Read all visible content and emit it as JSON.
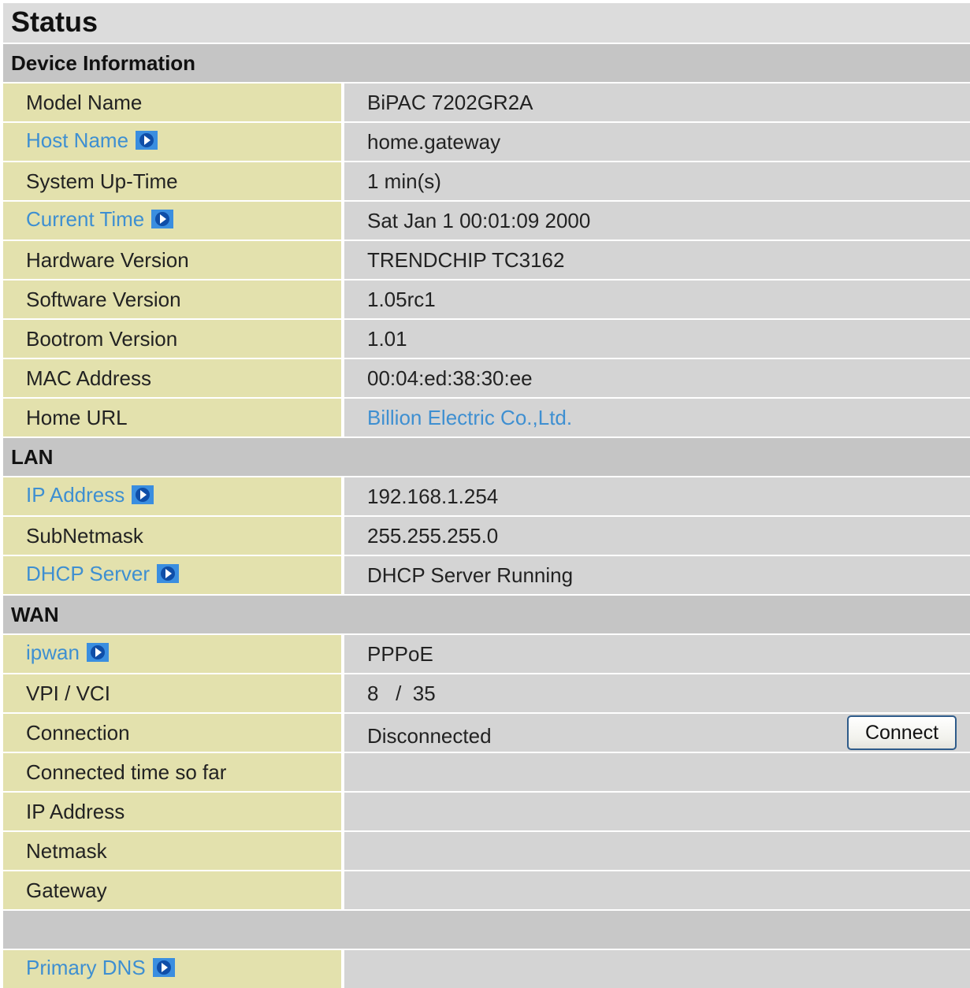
{
  "page": {
    "title": "Status"
  },
  "sections": {
    "device_information": "Device Information",
    "lan": "LAN",
    "wan": "WAN"
  },
  "device": {
    "model_name_label": "Model Name",
    "model_name_value": "BiPAC 7202GR2A",
    "host_name_label": "Host Name",
    "host_name_value": "home.gateway",
    "system_uptime_label": "System Up-Time",
    "system_uptime_value": "1 min(s)",
    "current_time_label": "Current Time",
    "current_time_value": "Sat Jan 1 00:01:09 2000",
    "hardware_version_label": "Hardware Version",
    "hardware_version_value": "TRENDCHIP TC3162",
    "software_version_label": "Software Version",
    "software_version_value": "1.05rc1",
    "bootrom_version_label": "Bootrom Version",
    "bootrom_version_value": "1.01",
    "mac_address_label": "MAC Address",
    "mac_address_value": "00:04:ed:38:30:ee",
    "home_url_label": "Home URL",
    "home_url_value": "Billion Electric Co.,Ltd."
  },
  "lan": {
    "ip_address_label": "IP Address",
    "ip_address_value": "192.168.1.254",
    "subnetmask_label": "SubNetmask",
    "subnetmask_value": "255.255.255.0",
    "dhcp_server_label": "DHCP Server",
    "dhcp_server_value": "DHCP Server Running"
  },
  "wan": {
    "ipwan_label": "ipwan",
    "ipwan_value": "PPPoE",
    "vpi_vci_label": "VPI / VCI",
    "vpi_vci_value": "8   /  35",
    "connection_label": "Connection",
    "connection_value": "Disconnected",
    "connect_button_label": "Connect",
    "connected_time_label": "Connected time so far",
    "connected_time_value": "",
    "ip_address_label": "IP Address",
    "ip_address_value": "",
    "netmask_label": "Netmask",
    "netmask_value": "",
    "gateway_label": "Gateway",
    "gateway_value": "",
    "primary_dns_label": "Primary DNS",
    "primary_dns_value": ""
  },
  "icons": {
    "row_link_icon": "arrow-right-icon",
    "accent_link_color": "#3e8fd1",
    "label_bg": "#e3e1ad",
    "value_bg": "#d4d4d4"
  }
}
